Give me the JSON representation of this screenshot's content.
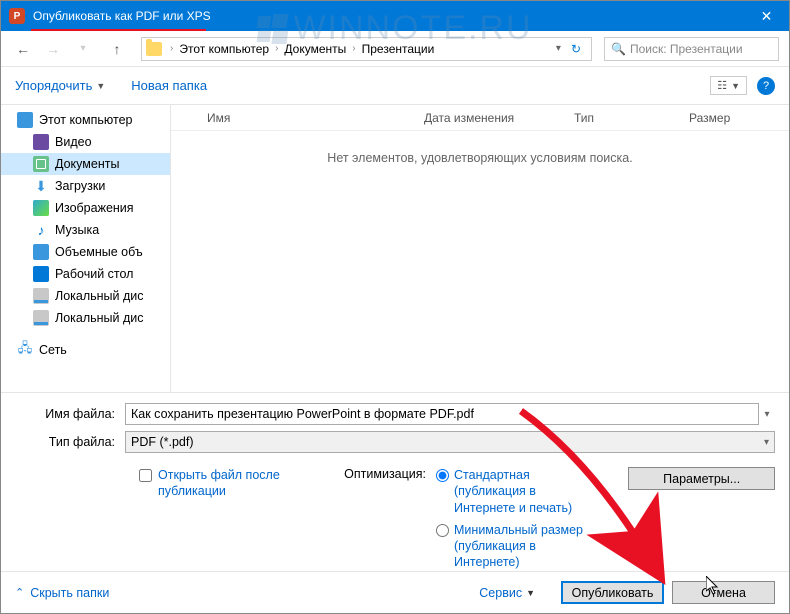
{
  "titlebar": {
    "title": "Опубликовать как PDF или XPS"
  },
  "watermark": "WINNOTE.RU",
  "breadcrumbs": [
    "Этот компьютер",
    "Документы",
    "Презентации"
  ],
  "search": {
    "placeholder": "Поиск: Презентации"
  },
  "toolbar": {
    "organize": "Упорядочить",
    "new_folder": "Новая папка"
  },
  "sidebar": {
    "this_pc": "Этот компьютер",
    "video": "Видео",
    "documents": "Документы",
    "downloads": "Загрузки",
    "images": "Изображения",
    "music": "Музыка",
    "objects3d": "Объемные объ",
    "desktop": "Рабочий стол",
    "disk1": "Локальный дис",
    "disk2": "Локальный дис",
    "network": "Сеть"
  },
  "columns": {
    "name": "Имя",
    "date": "Дата изменения",
    "type": "Тип",
    "size": "Размер"
  },
  "empty_message": "Нет элементов, удовлетворяющих условиям поиска.",
  "form": {
    "filename_label": "Имя файла:",
    "filename_value": "Как сохранить презентацию PowerPoint в формате PDF.pdf",
    "filetype_label": "Тип файла:",
    "filetype_value": "PDF (*.pdf)"
  },
  "options": {
    "open_after_label": "Открыть файл после публикации",
    "optimization_label": "Оптимизация:",
    "radio_standard": "Стандартная (публикация в Интернете и печать)",
    "radio_min": "Минимальный размер (публикация в Интернете)",
    "params_button": "Параметры..."
  },
  "footer": {
    "hide_folders": "Скрыть папки",
    "service": "Сервис",
    "publish": "Опубликовать",
    "cancel": "Отмена"
  }
}
